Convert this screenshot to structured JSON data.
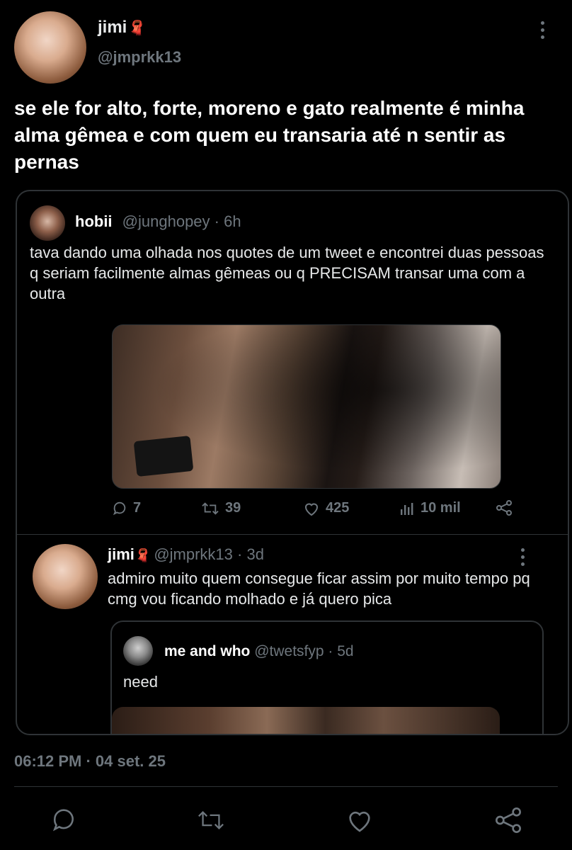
{
  "tweet": {
    "author": {
      "name": "jimi",
      "emoji": "🧣",
      "handle": "@jmprkk13"
    },
    "text": "se ele for alto, forte, moreno e gato realmente é minha alma gêmea e com quem eu transaria até n sentir as pernas",
    "timestamp": "06:12 PM · 04 set. 25"
  },
  "quoted": {
    "author": {
      "name": "hobii",
      "handle": "@junghopey",
      "time": "· 6h"
    },
    "text": "tava dando uma olhada nos quotes de um tweet e encontrei duas pessoas q seriam facilmente almas gêmeas ou q PRECISAM transar uma com a outra",
    "stats": {
      "replies": "7",
      "retweets": "39",
      "likes": "425",
      "views": "10 mil"
    }
  },
  "reply": {
    "author": {
      "name": "jimi",
      "emoji": "🧣",
      "handle": "@jmprkk13",
      "time": "· 3d"
    },
    "text": "admiro muito quem consegue ficar assim por muito tempo pq cmg vou ficando molhado e já quero pica",
    "quoted": {
      "author": {
        "name": "me and who",
        "handle": "@twetsfyp",
        "time": "· 5d"
      },
      "text": "need"
    }
  },
  "icons": {
    "reply": "reply-icon",
    "retweet": "retweet-icon",
    "like": "heart-icon",
    "views": "views-icon",
    "share": "share-icon",
    "more": "more-vertical-icon"
  },
  "colors": {
    "background": "#000000",
    "text": "#e7e9ea",
    "muted": "#6e767d",
    "border": "#2f3336",
    "emoji_accent": "#e0245e"
  }
}
